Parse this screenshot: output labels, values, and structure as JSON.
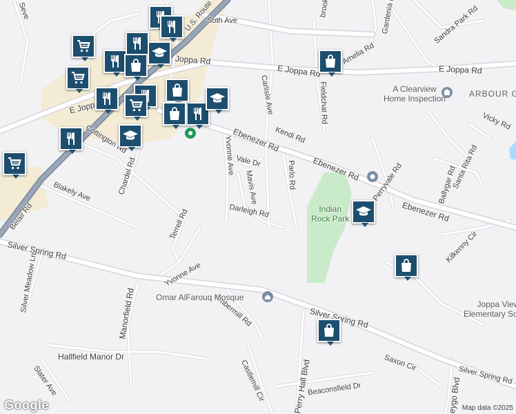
{
  "map": {
    "roads": {
      "e_joppa_rd_east": "E Joppa Rd",
      "e_joppa_rd_west": "E Joppa Rd",
      "joppa_rd": "Joppa Rd",
      "soth_ave": "Soth Ave",
      "us_route": "U.S. Route",
      "ebenezer_rd_1": "Ebenezer Rd",
      "ebenezer_rd_2": "Ebenezer Rd",
      "ebenezer_rd_3": "Ebenezer Rd",
      "kendi_rd": "Kendi Rd",
      "carlisle_ave": "Carlisle Ave",
      "fieldchat_rd": "Fieldchat Rd",
      "brook_rd": "brook Rd",
      "gardenia_rd": "Gardenia Rd",
      "amelia_rd": "Amelia Rd",
      "sandra_park_rd": "Sandra Park Rd",
      "yvonne_ave_north": "Yvonne Ave",
      "vale_dr": "Vale Dr",
      "mavis_ave": "Mavis Ave",
      "parlo_rd": "Parlo Rd",
      "darleigh_rd": "Darleigh Rd",
      "perryvale_rd": "Perryvale Rd",
      "santa_rita_rd": "Santa Rita Rd",
      "ballygar_rd": "Ballygar Rd",
      "vicky_rd": "Vicky Rd",
      "kilkenny_cir": "Kilkenny Cir",
      "cottington_rd": "Cottington Rd",
      "chardel_rd": "Chardel Rd",
      "blakely_ave": "Blakely Ave",
      "belair_rd": "Belair Rd",
      "terrell_rd": "Terrell Rd",
      "yvonne_ave_south": "Yvonne Ave",
      "silver_spring_rd_west": "Silver Spring Rd",
      "silver_meadow_ln": "Silver Meadow Ln",
      "manorfield_rd": "Manorfield Rd",
      "ambermill_rd": "Ambermill Rd",
      "silver_spring_rd_mid": "Silver Spring Rd",
      "hallfield_manor_dr": "Hallfield Manor Dr",
      "slater_ave": "Slater Ave",
      "castlemill_cir": "Castlemill Cir",
      "perry_hall_blvd": "Perry Hall Blvd",
      "beaconsfield_dr": "Beaconsfield Dr",
      "saxon_cir": "Saxon Cir",
      "silver_spring_rd_east": "Silver Spring Rd",
      "forge_blvd": "eygo Blvd",
      "seven_rd": "Seve"
    },
    "places": {
      "clearview": "A Clearview\nHome Inspection",
      "arbour": "ARBOUR G",
      "indian_rock_park": "Indian\nRock Park",
      "mosque": "Omar AlFarouq Mosque",
      "joppa_view": "Joppa View\nElementary School"
    },
    "attribution": "Map data ©2025",
    "logo": "Google",
    "colors": {
      "background": "#f2f1f4",
      "road": "#ffffff",
      "road_outline": "#d6d4dc",
      "highway": "#8e9aae",
      "commercial": "#f3ebd3",
      "park": "#c9ebc9",
      "water": "#aadaff",
      "pin": "#1d4e6e"
    }
  },
  "markers": [
    {
      "id": "restaurant-1",
      "icon": "fork-knife-icon"
    },
    {
      "id": "restaurant-2",
      "icon": "fork-knife-icon"
    },
    {
      "id": "restaurant-3",
      "icon": "fork-knife-icon"
    },
    {
      "id": "restaurant-4",
      "icon": "fork-knife-icon"
    },
    {
      "id": "restaurant-5",
      "icon": "fork-knife-icon"
    },
    {
      "id": "restaurant-6",
      "icon": "fork-knife-icon"
    },
    {
      "id": "restaurant-7",
      "icon": "fork-knife-icon"
    },
    {
      "id": "restaurant-8",
      "icon": "fork-knife-icon"
    },
    {
      "id": "grocery-1",
      "icon": "shopping-cart-icon"
    },
    {
      "id": "grocery-2",
      "icon": "shopping-cart-icon"
    },
    {
      "id": "grocery-3",
      "icon": "shopping-cart-icon"
    },
    {
      "id": "grocery-4",
      "icon": "shopping-cart-icon"
    },
    {
      "id": "shopping-1",
      "icon": "shopping-bag-icon"
    },
    {
      "id": "shopping-2",
      "icon": "shopping-bag-icon"
    },
    {
      "id": "shopping-3",
      "icon": "shopping-bag-icon"
    },
    {
      "id": "shopping-4",
      "icon": "shopping-bag-icon"
    },
    {
      "id": "shopping-5",
      "icon": "shopping-bag-icon"
    },
    {
      "id": "shopping-6",
      "icon": "shopping-bag-icon"
    },
    {
      "id": "school-1",
      "icon": "graduation-cap-icon"
    },
    {
      "id": "school-2",
      "icon": "graduation-cap-icon"
    },
    {
      "id": "school-3",
      "icon": "graduation-cap-icon"
    },
    {
      "id": "school-4",
      "icon": "graduation-cap-icon"
    }
  ]
}
